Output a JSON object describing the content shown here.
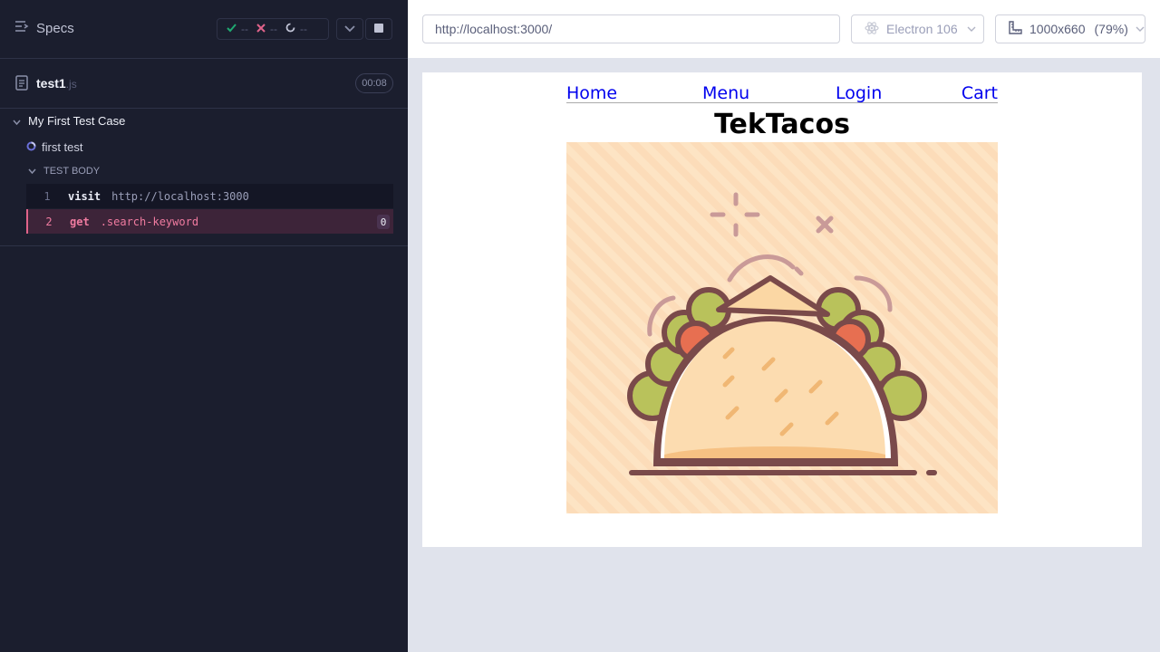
{
  "reporter": {
    "specs_label": "Specs",
    "stats": {
      "passed": "--",
      "failed": "--",
      "pending": "--"
    },
    "colors": {
      "passed": "#1fa971",
      "failed": "#e0638a",
      "pending": "#bfc2d4"
    },
    "file": {
      "name": "test1",
      "ext": ".js",
      "duration": "00:08"
    },
    "suite_title": "My First Test Case",
    "test_title": "first test",
    "body_label": "TEST BODY",
    "commands": [
      {
        "num": "1",
        "name": "visit",
        "arg": "http://localhost:3000",
        "count": ""
      },
      {
        "num": "2",
        "name": "get",
        "arg": ".search-keyword",
        "count": "0"
      }
    ]
  },
  "aut": {
    "url": "http://localhost:3000/",
    "browser": "Electron 106",
    "viewport": "1000x660",
    "scale": "(79%)"
  },
  "site": {
    "nav": [
      "Home",
      "Menu",
      "Login",
      "Cart"
    ],
    "title": "TekTacos"
  }
}
